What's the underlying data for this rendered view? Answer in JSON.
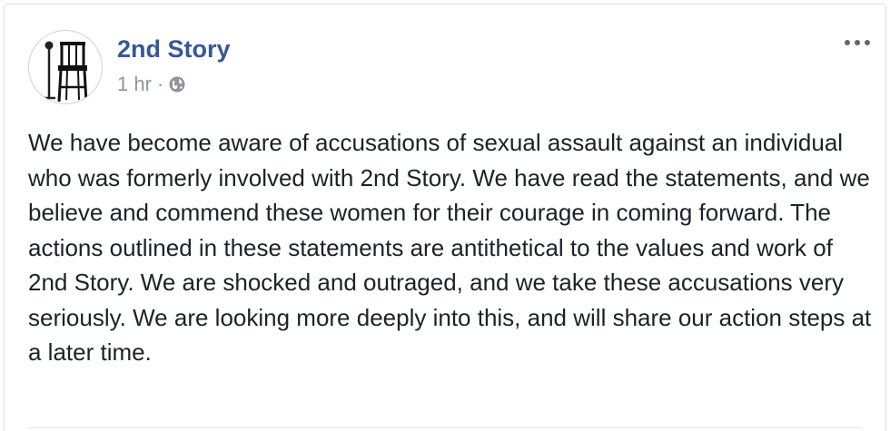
{
  "post": {
    "author": {
      "name": "2nd Story",
      "avatar_icon": "bar-stool-microphone-logo"
    },
    "meta": {
      "time": "1 hr",
      "separator": "·",
      "privacy_icon": "globe-icon"
    },
    "more_label": "•••",
    "body": "We have become aware of accusations of sexual assault against an individual who was formerly involved with 2nd Story. We have read the statements, and we believe and commend these women for their courage in coming forward. The actions outlined in these statements are antithetical to the values and work of 2nd Story. We are shocked and outraged, and we take these accusations very seriously. We are looking more deeply into this, and will share our action steps at a later time."
  },
  "colors": {
    "author_link": "#365899",
    "meta_text": "#90949c",
    "body_text": "#1d2129",
    "border": "#dddfe2"
  }
}
